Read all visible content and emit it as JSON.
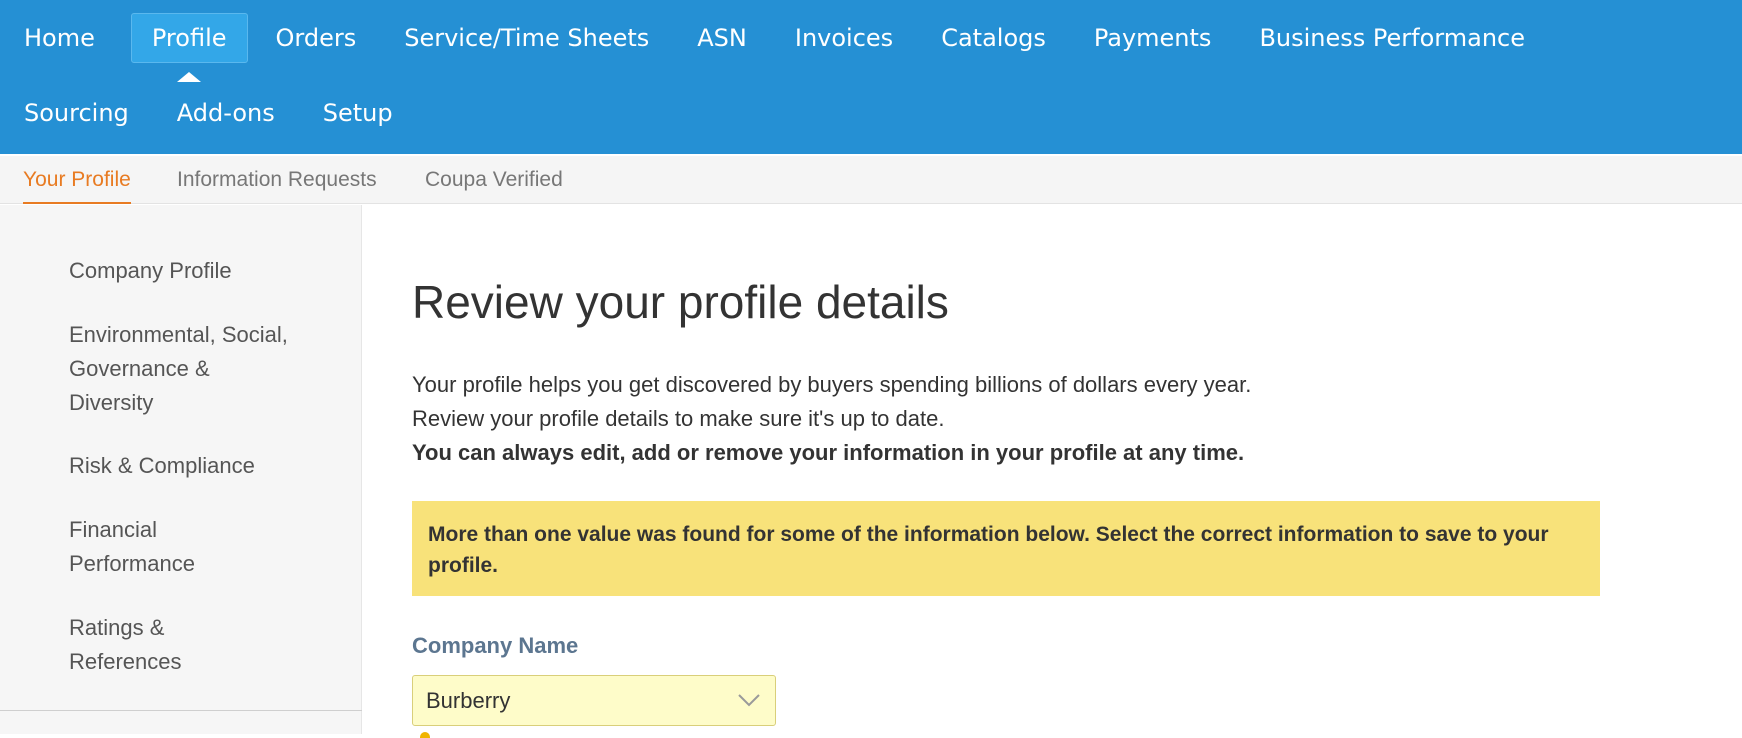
{
  "nav": {
    "row1": [
      "Home",
      "Profile",
      "Orders",
      "Service/Time Sheets",
      "ASN",
      "Invoices",
      "Catalogs",
      "Payments",
      "Business Performance"
    ],
    "row2": [
      "Sourcing",
      "Add-ons",
      "Setup"
    ],
    "active": "Profile"
  },
  "subnav": {
    "items": [
      "Your Profile",
      "Information Requests",
      "Coupa Verified"
    ],
    "active": "Your Profile"
  },
  "sidebar": {
    "items": [
      "Company Profile",
      "Environmental, Social, Governance & Diversity",
      "Risk & Compliance",
      "Financial Performance",
      "Ratings & References"
    ]
  },
  "main": {
    "title": "Review your profile details",
    "intro_line1": "Your profile helps you get discovered by buyers spending billions of dollars every year.",
    "intro_line2": "Review your profile details to make sure it's up to date.",
    "intro_line3": "You can always edit, add or remove your information in your profile at any time.",
    "alert": "More than one value was found for some of the information below. Select the correct information to save to your profile.",
    "company_name_label": "Company Name",
    "company_name_value": "Burberry"
  },
  "colors": {
    "nav_bg": "#2590d4",
    "nav_active_bg": "#33a7e8",
    "subnav_active": "#e87b22",
    "alert_bg": "#f8e27a",
    "select_bg": "#fefcc9",
    "label_color": "#5c7690"
  },
  "icons": {
    "select_toggle": "chevron-down-icon",
    "field_warning": "warning-icon"
  }
}
